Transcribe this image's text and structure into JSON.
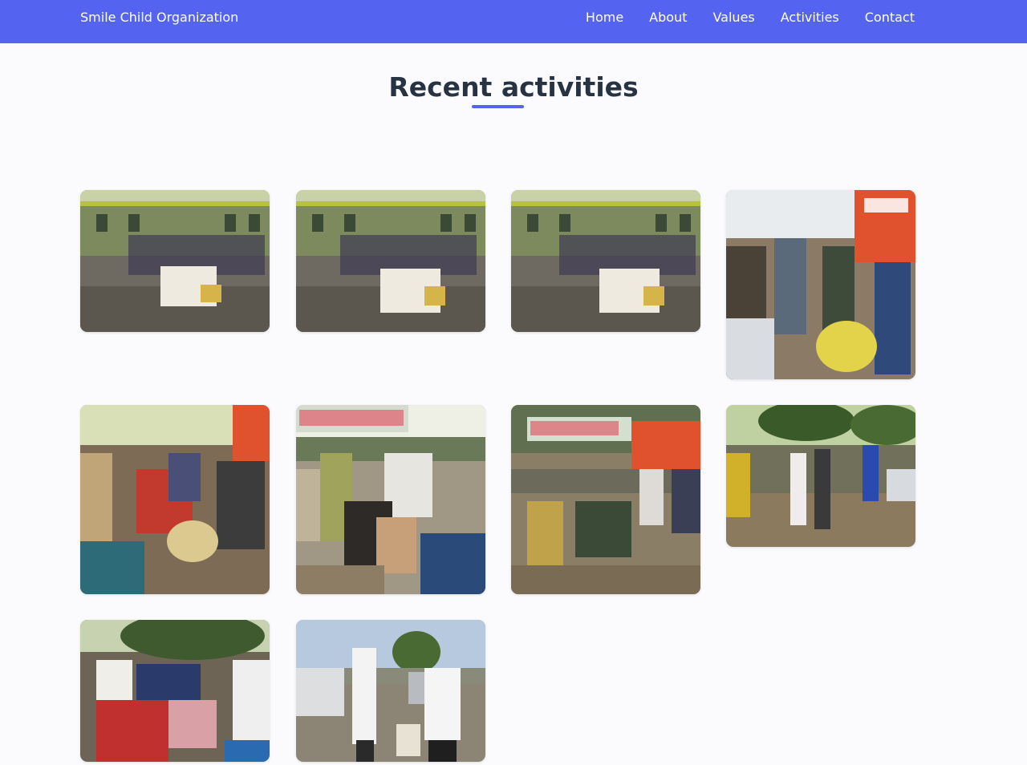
{
  "site": {
    "brand": "Smile Child Organization",
    "nav": [
      "Home",
      "About",
      "Values",
      "Activities",
      "Contact"
    ]
  },
  "activities": {
    "title": "Recent activities",
    "accent_color": "#5463f0",
    "photos": [
      {
        "scene": "building"
      },
      {
        "scene": "building"
      },
      {
        "scene": "building"
      },
      {
        "scene": "crowd-banner"
      },
      {
        "scene": "crowd-banner"
      },
      {
        "scene": "street-sign"
      },
      {
        "scene": "street-sign"
      },
      {
        "scene": "trees-crowd"
      },
      {
        "scene": "trees-crowd"
      },
      {
        "scene": "car-walk"
      }
    ]
  }
}
